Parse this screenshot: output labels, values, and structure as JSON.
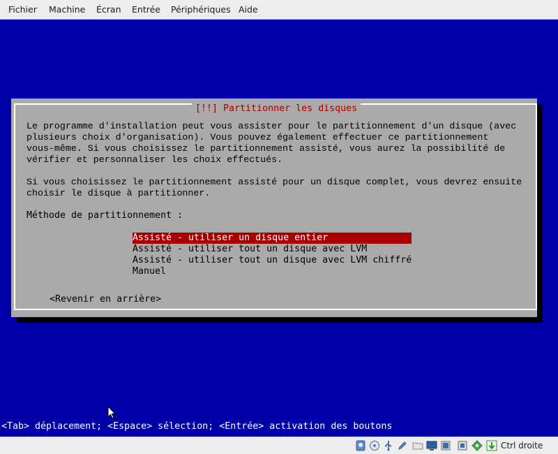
{
  "menubar": {
    "items": [
      "Fichier",
      "Machine",
      "Écran",
      "Entrée",
      "Périphériques",
      "Aide"
    ]
  },
  "dialog": {
    "title": "[!!] Partitionner les disques",
    "paragraph1": "Le programme d'installation peut vous assister pour le partitionnement d'un disque (avec\nplusieurs choix d'organisation). Vous pouvez également effectuer ce partitionnement\nvous-même. Si vous choisissez le partitionnement assisté, vous aurez la possibilité de\nvérifier et personnaliser les choix effectués.",
    "paragraph2": "Si vous choisissez le partitionnement assisté pour un disque complet, vous devrez ensuite\nchoisir le disque à partitionner.",
    "method_label": "Méthode de partitionnement :",
    "options": [
      "Assisté - utiliser un disque entier",
      "Assisté - utiliser tout un disque avec LVM",
      "Assisté - utiliser tout un disque avec LVM chiffré",
      "Manuel"
    ],
    "selected_index": 0,
    "back_button": "<Revenir en arrière>"
  },
  "help_line": "<Tab> déplacement; <Espace> sélection; <Entrée> activation des boutons",
  "statusbar": {
    "icons": [
      "hard-disk-icon",
      "optical-drive-icon",
      "usb-icon",
      "pencil-icon",
      "shared-folder-icon",
      "display-icon",
      "video-capture-icon",
      "network-icon",
      "cpu-icon",
      "mouse-integration-icon",
      "arrow-down-icon"
    ],
    "host_key": "Ctrl droite"
  },
  "colors": {
    "screen_bg": "#0000a8",
    "dialog_bg": "#aaaaaa",
    "title_red": "#a80000",
    "selection_bg": "#a80000"
  }
}
